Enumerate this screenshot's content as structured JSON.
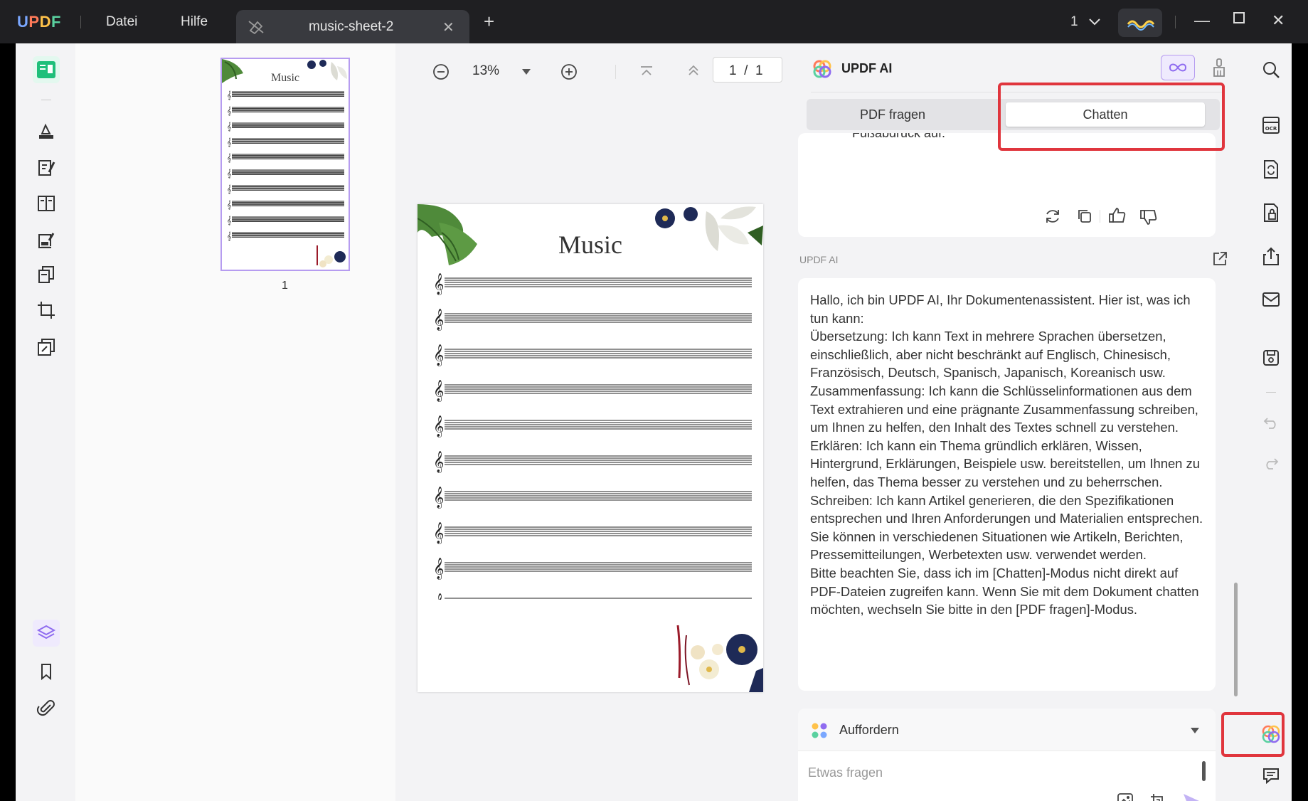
{
  "titlebar": {
    "logo": "UPDF",
    "menu": [
      "Datei",
      "Hilfe"
    ],
    "tab_label": "music-sheet-2",
    "page_selector": "1"
  },
  "viewer": {
    "zoom": "13%",
    "page_current": "1",
    "page_total": "1",
    "thumbnail_page_number": "1",
    "page_title": "Music",
    "staff_count": 10
  },
  "ai": {
    "title": "UPDF AI",
    "tabs": [
      "PDF fragen",
      "Chatten"
    ],
    "selected_tab": "Chatten",
    "previous_message_tail": "Fußabdruck auf.",
    "sender": "UPDF AI",
    "reply_paragraphs": [
      "Hallo, ich bin UPDF AI, Ihr Dokumentenassistent. Hier ist, was ich tun kann:",
      "Übersetzung: Ich kann Text in mehrere Sprachen übersetzen, einschließlich, aber nicht beschränkt auf Englisch, Chinesisch, Französisch, Deutsch, Spanisch, Japanisch, Koreanisch usw.",
      "Zusammenfassung: Ich kann die Schlüsselinformationen aus dem Text extrahieren und eine prägnante Zusammenfassung schreiben, um Ihnen zu helfen, den Inhalt des Textes schnell zu verstehen.",
      "Erklären: Ich kann ein Thema gründlich erklären, Wissen, Hintergrund, Erklärungen, Beispiele usw. bereitstellen, um Ihnen zu helfen, das Thema besser zu verstehen und zu beherrschen.",
      "Schreiben: Ich kann Artikel generieren, die den Spezifikationen entsprechen und Ihren Anforderungen und Materialien entsprechen. Sie können in verschiedenen Situationen wie Artikeln, Berichten, Pressemitteilungen, Werbetexten usw. verwendet werden.",
      "Bitte beachten Sie, dass ich im [Chatten]-Modus nicht direkt auf PDF-Dateien zugreifen kann. Wenn Sie mit dem Dokument chatten möchten, wechseln Sie bitte in den [PDF fragen]-Modus."
    ],
    "prompt_label": "Auffordern",
    "input_placeholder": "Etwas fragen"
  },
  "colors": {
    "accent_green": "#1fbf7a",
    "accent_purple": "#8f6cf0",
    "highlight_red": "#e0353d",
    "titlebar_bg": "#1f1f22"
  }
}
